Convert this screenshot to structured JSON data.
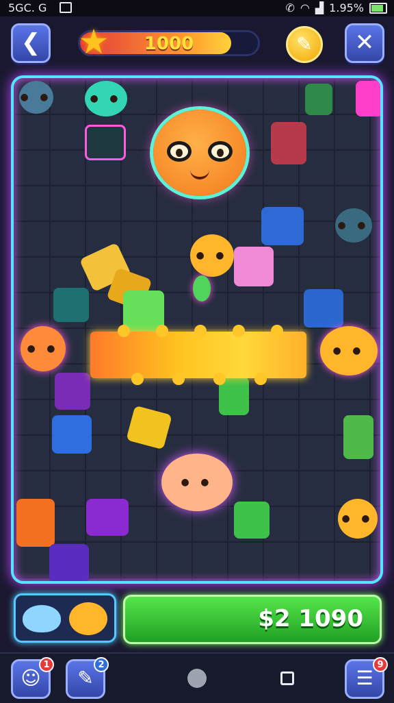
{
  "status_bar": {
    "network": "5G",
    "carrier": "G",
    "battery": "1.95%",
    "battery_level": 0.95
  },
  "header": {
    "back_icon": "arrow-left-icon",
    "score": "1000",
    "score_progress": 0.85,
    "hint_icon": "pencil-icon",
    "close_icon": "close-icon"
  },
  "board": {
    "highlight_color": "#56e4ff",
    "glow_color": "#b64bff"
  },
  "bottom": {
    "money_label": "$2 1090"
  },
  "nav": {
    "left_badge": "1",
    "middle_badge": "2",
    "menu_badge": "9"
  },
  "colors": {
    "accent": "#5a74e8",
    "money": "#3ec93a",
    "score": "#ffe23a"
  }
}
